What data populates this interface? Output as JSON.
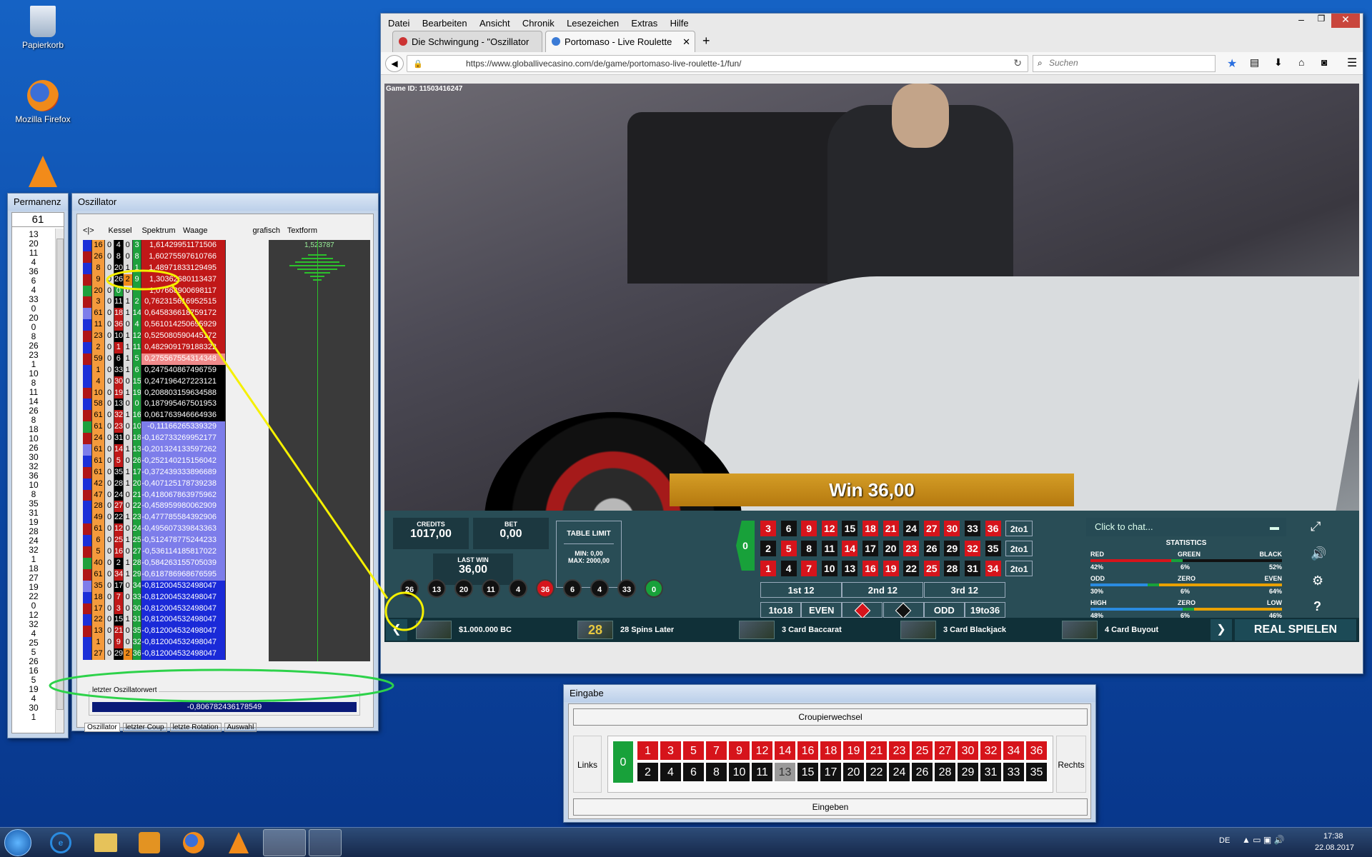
{
  "desktop": {
    "icons": [
      {
        "label": "Papierkorb",
        "icon": "recycle-bin-icon"
      },
      {
        "label": "Mozilla Firefox",
        "icon": "firefox-icon"
      },
      {
        "label": "",
        "icon": "vlc-icon"
      }
    ]
  },
  "permanenz": {
    "title": "Permanenz",
    "count": "61",
    "numbers": [
      "13",
      "20",
      "11",
      "4",
      "36",
      "6",
      "4",
      "33",
      "0",
      "20",
      "0",
      "8",
      "26",
      "23",
      "1",
      "10",
      "8",
      "11",
      "14",
      "26",
      "8",
      "18",
      "10",
      "26",
      "30",
      "32",
      "36",
      "10",
      "8",
      "35",
      "31",
      "19",
      "28",
      "24",
      "32",
      "1",
      "18",
      "27",
      "19",
      "22",
      "0",
      "12",
      "32",
      "4",
      "25",
      "5",
      "26",
      "16",
      "5",
      "19",
      "4",
      "30",
      "1"
    ]
  },
  "oszillator": {
    "title": "Oszillator",
    "headers": {
      "nav": "<|>",
      "kessel": "Kessel",
      "spektrum": "Spektrum",
      "waage": "Waage",
      "grafisch": "grafisch",
      "textform": "Textform"
    },
    "graph_peak": "1,523787",
    "rows": [
      {
        "k": "16",
        "a": "0",
        "b": "4",
        "c": "0",
        "d": "3",
        "w": "1,61429951171506"
      },
      {
        "k": "26",
        "a": "0",
        "b": "8",
        "c": "0",
        "d": "8",
        "w": "1,60275597610766"
      },
      {
        "k": "8",
        "a": "0",
        "b": "20",
        "c": "1",
        "d": "1",
        "w": "1,48971833129495"
      },
      {
        "k": "9",
        "a": "0",
        "b": "26",
        "c": "2",
        "d": "9",
        "w": "1,30362680113437"
      },
      {
        "k": "20",
        "a": "0",
        "b": "0",
        "c": "0",
        "d": "",
        "w": "1,07668900698117"
      },
      {
        "k": "3",
        "a": "0",
        "b": "11",
        "c": "1",
        "d": "2",
        "w": "0,762315616952515"
      },
      {
        "k": "61",
        "a": "0",
        "b": "18",
        "c": "1",
        "d": "14",
        "w": "0,645836618759172"
      },
      {
        "k": "11",
        "a": "0",
        "b": "36",
        "c": "0",
        "d": "4",
        "w": "0,561014250695929"
      },
      {
        "k": "23",
        "a": "0",
        "b": "10",
        "c": "1",
        "d": "12",
        "w": "0,525080590445172"
      },
      {
        "k": "2",
        "a": "0",
        "b": "1",
        "c": "1",
        "d": "11",
        "w": "0,482909179188322"
      },
      {
        "k": "59",
        "a": "0",
        "b": "6",
        "c": "1",
        "d": "5",
        "w": "0,275567554314348"
      },
      {
        "k": "1",
        "a": "0",
        "b": "33",
        "c": "1",
        "d": "6",
        "w": "0,247540867496759"
      },
      {
        "k": "4",
        "a": "0",
        "b": "30",
        "c": "0",
        "d": "15",
        "w": "0,247196427223121"
      },
      {
        "k": "10",
        "a": "0",
        "b": "19",
        "c": "1",
        "d": "19",
        "w": "0,208803159634588"
      },
      {
        "k": "58",
        "a": "0",
        "b": "13",
        "c": "0",
        "d": "0",
        "w": "0,187995467501953"
      },
      {
        "k": "61",
        "a": "0",
        "b": "32",
        "c": "1",
        "d": "16",
        "w": "0,061763946664936"
      },
      {
        "k": "61",
        "a": "0",
        "b": "23",
        "c": "0",
        "d": "10",
        "w": "-0,11166265339329"
      },
      {
        "k": "24",
        "a": "0",
        "b": "31",
        "c": "0",
        "d": "18",
        "w": "-0,162733269952177"
      },
      {
        "k": "61",
        "a": "0",
        "b": "14",
        "c": "1",
        "d": "13",
        "w": "-0,201324133597262"
      },
      {
        "k": "61",
        "a": "0",
        "b": "5",
        "c": "0",
        "d": "26",
        "w": "-0,252140215156042"
      },
      {
        "k": "61",
        "a": "0",
        "b": "35",
        "c": "1",
        "d": "17",
        "w": "-0,372439333896689"
      },
      {
        "k": "42",
        "a": "0",
        "b": "28",
        "c": "1",
        "d": "20",
        "w": "-0,407125178739238"
      },
      {
        "k": "47",
        "a": "0",
        "b": "24",
        "c": "0",
        "d": "21",
        "w": "-0,418067863975962"
      },
      {
        "k": "28",
        "a": "0",
        "b": "27",
        "c": "0",
        "d": "22",
        "w": "-0,458959980062909"
      },
      {
        "k": "49",
        "a": "0",
        "b": "22",
        "c": "1",
        "d": "23",
        "w": "-0,477785584392906"
      },
      {
        "k": "61",
        "a": "0",
        "b": "12",
        "c": "0",
        "d": "24",
        "w": "-0,495607339843363"
      },
      {
        "k": "6",
        "a": "0",
        "b": "25",
        "c": "1",
        "d": "25",
        "w": "-0,512478775244233"
      },
      {
        "k": "5",
        "a": "0",
        "b": "16",
        "c": "0",
        "d": "27",
        "w": "-0,536114185817022"
      },
      {
        "k": "40",
        "a": "0",
        "b": "2",
        "c": "1",
        "d": "28",
        "w": "-0,584263155705039"
      },
      {
        "k": "61",
        "a": "0",
        "b": "34",
        "c": "1",
        "d": "29",
        "w": "-0,618786968676595"
      },
      {
        "k": "35",
        "a": "0",
        "b": "17",
        "c": "0",
        "d": "34",
        "w": "-0,812004532498047"
      },
      {
        "k": "18",
        "a": "0",
        "b": "7",
        "c": "0",
        "d": "33",
        "w": "-0,812004532498047"
      },
      {
        "k": "17",
        "a": "0",
        "b": "3",
        "c": "0",
        "d": "30",
        "w": "-0,812004532498047"
      },
      {
        "k": "22",
        "a": "0",
        "b": "15",
        "c": "1",
        "d": "31",
        "w": "-0,812004532498047"
      },
      {
        "k": "13",
        "a": "0",
        "b": "21",
        "c": "0",
        "d": "35",
        "w": "-0,812004532498047"
      },
      {
        "k": "1",
        "a": "0",
        "b": "9",
        "c": "0",
        "d": "32",
        "w": "-0,812004532498047"
      },
      {
        "k": "27",
        "a": "0",
        "b": "29",
        "c": "2",
        "d": "36",
        "w": "-0,812004532498047"
      }
    ],
    "last_label": "letzter Oszillatorwert",
    "last_value": "-0,806782436178549",
    "tabs": [
      "Oszillator",
      "letzter Coup",
      "letzte Rotation",
      "Auswahl"
    ]
  },
  "browser": {
    "menu": [
      "Datei",
      "Bearbeiten",
      "Ansicht",
      "Chronik",
      "Lesezeichen",
      "Extras",
      "Hilfe"
    ],
    "tabs": [
      {
        "label": "Die Schwingung - \"Oszillator"
      },
      {
        "label": "Portomaso - Live Roulette"
      }
    ],
    "url": "https://www.globallivecasino.com/de/game/portomaso-live-roulette-1/fun/",
    "search_placeholder": "Suchen",
    "game_id": "Game ID: 11503416247"
  },
  "game": {
    "win_banner": "Win 36,00",
    "credits_label": "CREDITS",
    "credits": "1017,00",
    "bet_label": "BET",
    "bet": "0,00",
    "last_win_label": "LAST WIN",
    "last_win": "36,00",
    "table_limit_label": "TABLE LIMIT",
    "min": "MIN: 0,00",
    "max": "MAX: 2000,00",
    "history": [
      {
        "n": "26",
        "c": "blk"
      },
      {
        "n": "13",
        "c": "blk"
      },
      {
        "n": "20",
        "c": "blk"
      },
      {
        "n": "11",
        "c": "blk"
      },
      {
        "n": "4",
        "c": "blk"
      },
      {
        "n": "36",
        "c": "red"
      },
      {
        "n": "6",
        "c": "blk"
      },
      {
        "n": "4",
        "c": "blk"
      },
      {
        "n": "33",
        "c": "blk"
      },
      {
        "n": "0",
        "c": "grn"
      }
    ],
    "board_rows": [
      [
        "3",
        "6",
        "9",
        "12",
        "15",
        "18",
        "21",
        "24",
        "27",
        "30",
        "33",
        "36"
      ],
      [
        "2",
        "5",
        "8",
        "11",
        "14",
        "17",
        "20",
        "23",
        "26",
        "29",
        "32",
        "35"
      ],
      [
        "1",
        "4",
        "7",
        "10",
        "13",
        "16",
        "19",
        "22",
        "25",
        "28",
        "31",
        "34"
      ]
    ],
    "column_bet": "2to1",
    "dozens": [
      "1st 12",
      "2nd 12",
      "3rd 12"
    ],
    "outside": [
      "1to18",
      "EVEN",
      "",
      "",
      "ODD",
      "19to36"
    ],
    "chat_placeholder": "Click to chat...",
    "stats_title": "STATISTICS",
    "stats": [
      {
        "l": "RED",
        "m": "GREEN",
        "r": "BLACK",
        "lv": "42%",
        "mv": "6%",
        "rv": "52%"
      },
      {
        "l": "ODD",
        "m": "ZERO",
        "r": "EVEN",
        "lv": "30%",
        "mv": "6%",
        "rv": "64%"
      },
      {
        "l": "HIGH",
        "m": "ZERO",
        "r": "LOW",
        "lv": "48%",
        "mv": "6%",
        "rv": "46%"
      }
    ],
    "games_bar": [
      "$1.000.000 BC",
      "28 Spins Later",
      "3 Card Baccarat",
      "3 Card Blackjack",
      "4 Card Buyout"
    ],
    "games_bar_badge": "28",
    "real_play": "REAL SPIELEN"
  },
  "eingabe": {
    "title": "Eingabe",
    "croupier": "Croupierwechsel",
    "left": "Links",
    "right": "Rechts",
    "zero": "0",
    "top": [
      "1",
      "3",
      "5",
      "7",
      "9",
      "12",
      "14",
      "16",
      "18",
      "19",
      "21",
      "23",
      "25",
      "27",
      "30",
      "32",
      "34",
      "36"
    ],
    "bottom": [
      "2",
      "4",
      "6",
      "8",
      "10",
      "11",
      "13",
      "15",
      "17",
      "20",
      "22",
      "24",
      "26",
      "28",
      "29",
      "31",
      "33",
      "35"
    ],
    "submit": "Eingeben"
  },
  "taskbar": {
    "lang": "DE",
    "time": "17:38",
    "date": "22.08.2017"
  }
}
